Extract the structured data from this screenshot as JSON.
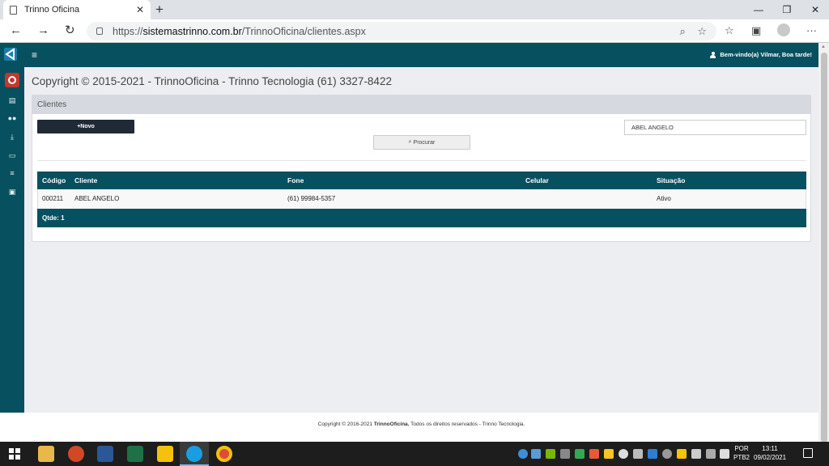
{
  "browser": {
    "tab_title": "Trinno Oficina",
    "tab_close": "✕",
    "new_tab": "+",
    "url_scheme": "https://",
    "url_host": "sistemastrinno.com.br",
    "url_path": "/TrinnoOficina/clientes.aspx",
    "window": {
      "minimize": "—",
      "restore": "❐",
      "close": "✕"
    },
    "nav": {
      "back": "←",
      "forward": "→",
      "refresh": "↻",
      "more": "···"
    }
  },
  "sidebar": {
    "icons": [
      "database-icon",
      "users-icon",
      "download-icon",
      "print-icon",
      "list-icon",
      "report-icon"
    ]
  },
  "header": {
    "menu_icon": "≡",
    "welcome": "Bem-vindo(a) Vilmar, Boa tarde!"
  },
  "page": {
    "copyright_title": "Copyright © 2015-2021 - TrinnoOficina - Trinno Tecnologia (61) 3327-8422"
  },
  "panel": {
    "title": "Clientes",
    "new_button": "+Novo",
    "search_value": "ABEL ANGELO",
    "search_button": "Procurar"
  },
  "table": {
    "columns": [
      "Código",
      "Cliente",
      "Fone",
      "Celular",
      "Situação"
    ],
    "rows": [
      {
        "codigo": "000211",
        "cliente": "ABEL ANGELO",
        "fone": "(61) 99984-5357",
        "celular": "",
        "situacao": "Ativo"
      }
    ],
    "footer": "Qtde: 1"
  },
  "footer": {
    "prefix": "Copyright © 2016-2021 ",
    "brand": "TrinnoOficina.",
    "suffix": " Todos os direitos reservados - Trinno Tecnologia."
  },
  "taskbar": {
    "lang_top": "POR",
    "lang_bottom": "PTB2",
    "time": "13:11",
    "date": "09/02/2021"
  },
  "colors": {
    "primary": "#06505f",
    "dark_button": "#1f2a36",
    "content_bg": "#eceef2"
  }
}
